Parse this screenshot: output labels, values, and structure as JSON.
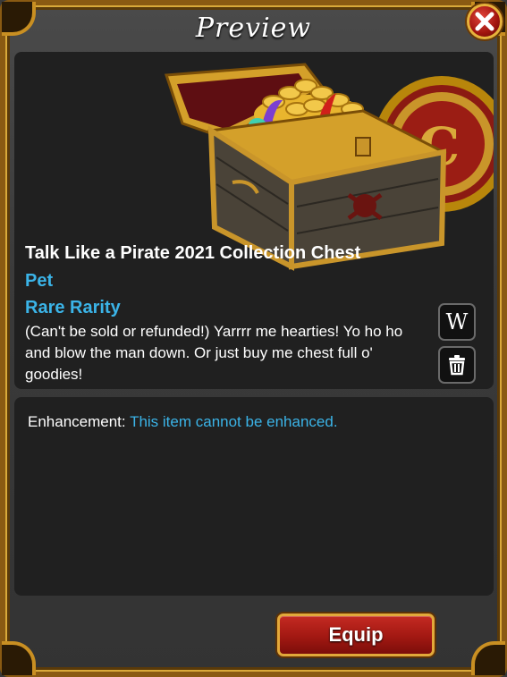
{
  "window": {
    "title": "Preview"
  },
  "item": {
    "name": "Talk Like a Pirate 2021 Collection Chest",
    "type": "Pet",
    "rarity": "Rare Rarity",
    "description": "(Can't be sold or refunded!) Yarrrr me hearties! Yo ho ho and blow the man down.  Or just buy me chest full o' goodies!"
  },
  "buttons": {
    "wiki_label": "W",
    "equip_label": "Equip",
    "close_icon": "x-icon",
    "delete_icon": "trash-icon"
  },
  "enhancement": {
    "label": "Enhancement:",
    "value": "This item cannot be enhanced."
  },
  "colors": {
    "accent_blue": "#3bb4e8",
    "gold": "#e2a93a",
    "button_red": "#a21812",
    "panel_bg": "#202020"
  }
}
